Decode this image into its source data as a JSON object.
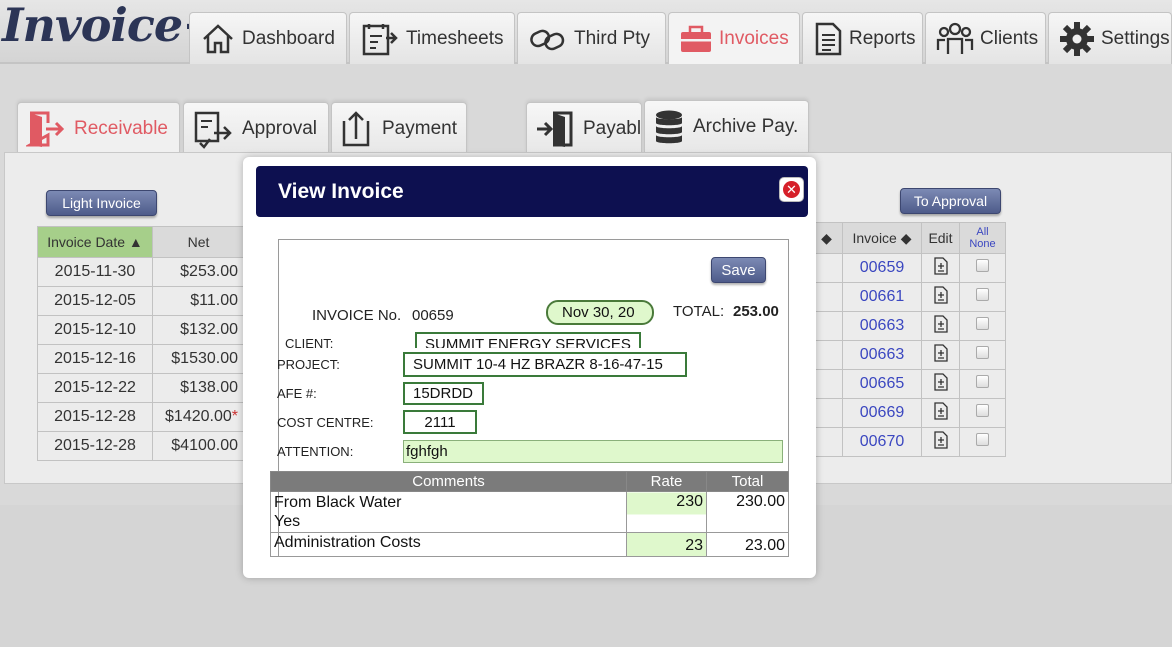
{
  "app": {
    "logo": "Invoice+"
  },
  "nav": {
    "tabs": [
      {
        "label": "Dashboard",
        "icon": "home-icon"
      },
      {
        "label": "Timesheets",
        "icon": "timesheet-icon"
      },
      {
        "label": "Third Pty",
        "icon": "link-icon"
      },
      {
        "label": "Invoices",
        "icon": "briefcase-icon",
        "active": true
      },
      {
        "label": "Reports",
        "icon": "document-icon"
      },
      {
        "label": "Clients",
        "icon": "people-icon"
      },
      {
        "label": "Settings",
        "icon": "gear-icon"
      }
    ]
  },
  "subtabs": [
    {
      "label": "Receivable",
      "icon": "exit-door-icon",
      "active": true
    },
    {
      "label": "Approval",
      "icon": "approval-icon"
    },
    {
      "label": "Payment",
      "icon": "upload-icon"
    },
    {
      "label": "Payable",
      "icon": "enter-door-icon"
    },
    {
      "label": "Archive Pay.",
      "icon": "database-icon"
    }
  ],
  "buttons": {
    "light_invoice": "Light Invoice",
    "to_approval": "To Approval",
    "save": "Save"
  },
  "left_table": {
    "headers": {
      "date": "Invoice Date ▲",
      "net": "Net"
    },
    "rows": [
      {
        "date": "2015-11-30",
        "net": "$253.00"
      },
      {
        "date": "2015-12-05",
        "net": "$11.00"
      },
      {
        "date": "2015-12-10",
        "net": "$132.00"
      },
      {
        "date": "2015-12-16",
        "net": "$1530.00"
      },
      {
        "date": "2015-12-22",
        "net": "$138.00"
      },
      {
        "date": "2015-12-28",
        "net": "$1420.00",
        "flag": "*"
      },
      {
        "date": "2015-12-28",
        "net": "$4100.00"
      }
    ]
  },
  "right_table": {
    "headers": {
      "sort": "◆",
      "invoice": "Invoice ◆",
      "edit": "Edit",
      "all": "All",
      "none": "None"
    },
    "rows": [
      "00659",
      "00661",
      "00663",
      "00663",
      "00665",
      "00669",
      "00670"
    ]
  },
  "modal": {
    "title": "View Invoice",
    "invoice_label": "INVOICE No.",
    "invoice_no": "00659",
    "date": "Nov 30, 20",
    "total_label": "TOTAL:",
    "total_value": "253.00",
    "client_label": "CLIENT:",
    "client": "SUMMIT ENERGY SERVICES",
    "project_label": "PROJECT:",
    "project": "SUMMIT 10-4 HZ BRAZR 8-16-47-15",
    "afe_label": "AFE #:",
    "afe": "15DRDD",
    "cost_centre_label": "COST CENTRE:",
    "cost_centre": "2111",
    "attention_label": "ATTENTION:",
    "attention": "fghfgh",
    "lines_headers": {
      "comments": "Comments",
      "rate": "Rate",
      "total": "Total"
    },
    "lines": [
      {
        "comment_1": "From Black Water",
        "comment_2": "Yes",
        "rate": "230",
        "total": "230.00"
      },
      {
        "comment_1": "Administration Costs",
        "rate": "23",
        "total": "23.00"
      }
    ]
  }
}
